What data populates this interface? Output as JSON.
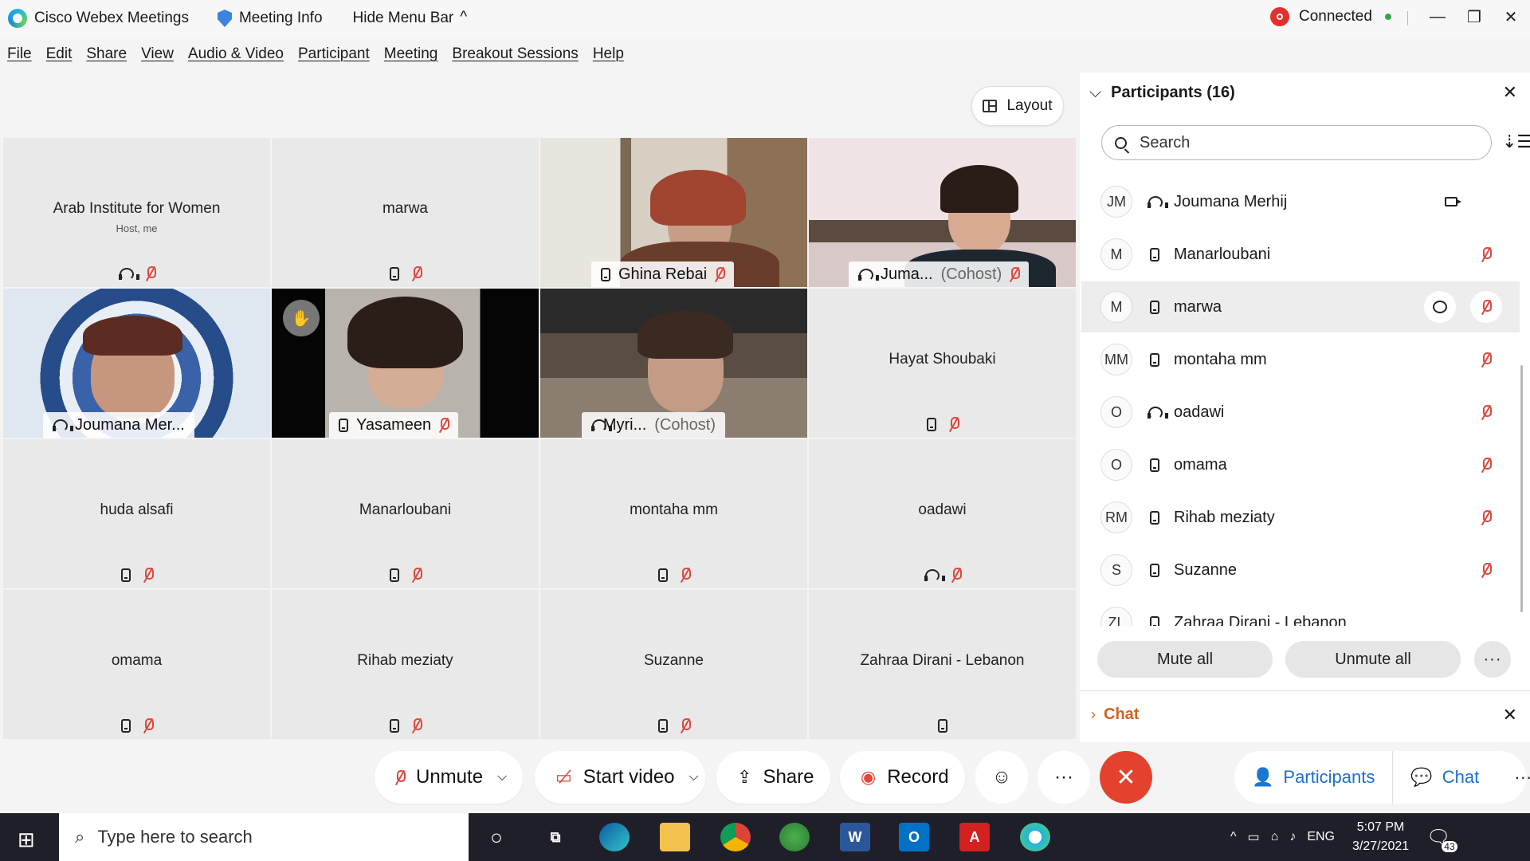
{
  "titlebar": {
    "app_name": "Cisco Webex Meetings",
    "meeting_info": "Meeting Info",
    "hide_menu": "Hide Menu Bar",
    "caret": "^",
    "status": "Connected",
    "minimize": "—",
    "restore": "❐",
    "close": "✕"
  },
  "menu": [
    "File",
    "Edit",
    "Share",
    "View",
    "Audio & Video",
    "Participant",
    "Meeting",
    "Breakout Sessions",
    "Help"
  ],
  "layout_label": "Layout",
  "tiles": [
    {
      "name": "Arab Institute for Women",
      "sub": "Host, me"
    },
    {
      "name": "marwa"
    },
    {
      "name": "Ghina Rebai"
    },
    {
      "name": "Juma...",
      "extra": "(Cohost)"
    },
    {
      "name": "Joumana Mer..."
    },
    {
      "name": "Yasameen"
    },
    {
      "name": "Myri...",
      "extra": "(Cohost)"
    },
    {
      "name": "Hayat Shoubaki"
    },
    {
      "name": "huda alsafi"
    },
    {
      "name": "Manarloubani"
    },
    {
      "name": "montaha mm"
    },
    {
      "name": "oadawi"
    },
    {
      "name": "omama"
    },
    {
      "name": "Rihab meziaty"
    },
    {
      "name": "Suzanne"
    },
    {
      "name": "Zahraa Dirani - Lebanon"
    }
  ],
  "panel": {
    "title": "Participants (16)",
    "close": "✕",
    "search_placeholder": "Search",
    "participants": [
      {
        "initials": "JM",
        "name": "Joumana Merhij"
      },
      {
        "initials": "M",
        "name": "Manarloubani"
      },
      {
        "initials": "M",
        "name": "marwa"
      },
      {
        "initials": "MM",
        "name": "montaha mm"
      },
      {
        "initials": "O",
        "name": "oadawi"
      },
      {
        "initials": "O",
        "name": "omama"
      },
      {
        "initials": "RM",
        "name": "Rihab meziaty"
      },
      {
        "initials": "S",
        "name": "Suzanne"
      },
      {
        "initials": "ZL",
        "name": "Zahraa Dirani - Lebanon"
      }
    ],
    "mute_all": "Mute all",
    "unmute_all": "Unmute all",
    "more": "···",
    "chat_label": "Chat",
    "chat_close": "✕"
  },
  "controls": {
    "unmute": "Unmute",
    "start_video": "Start video",
    "share": "Share",
    "record": "Record",
    "more": "···",
    "participants": "Participants",
    "chat": "Chat"
  },
  "taskbar": {
    "search": "Type here to search",
    "lang": "ENG",
    "time": "5:07 PM",
    "date": "3/27/2021",
    "notif_count": "43"
  }
}
